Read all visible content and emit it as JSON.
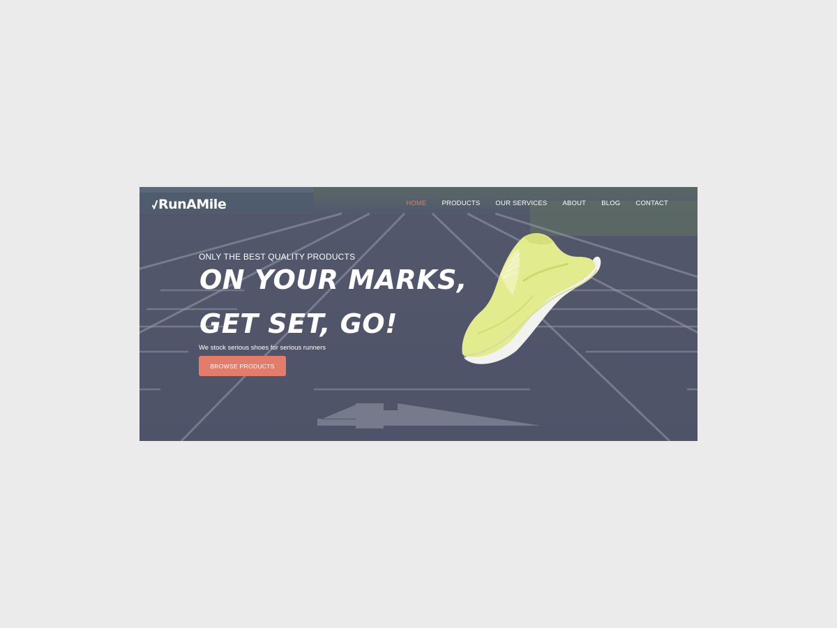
{
  "brand": {
    "name": "RunAMile"
  },
  "nav": {
    "items": [
      {
        "label": "HOME",
        "active": true
      },
      {
        "label": "PRODUCTS",
        "active": false
      },
      {
        "label": "OUR SERVICES",
        "active": false
      },
      {
        "label": "ABOUT",
        "active": false
      },
      {
        "label": "BLOG",
        "active": false
      },
      {
        "label": "CONTACT",
        "active": false
      }
    ]
  },
  "hero": {
    "eyebrow": "ONLY THE BEST QUALITY PRODUCTS",
    "headline_line1": "ON YOUR MARKS,",
    "headline_line2": "GET SET, GO!",
    "subtext": "We stock serious shoes for serious runners",
    "cta_label": "BROWSE PRODUCTS"
  },
  "colors": {
    "accent": "#e47c6b",
    "page_bg": "#ebebeb",
    "shoe": "#e3eb8f"
  },
  "icons": {
    "logo": "check-mark-icon",
    "hero_image": "running-shoe-icon"
  }
}
